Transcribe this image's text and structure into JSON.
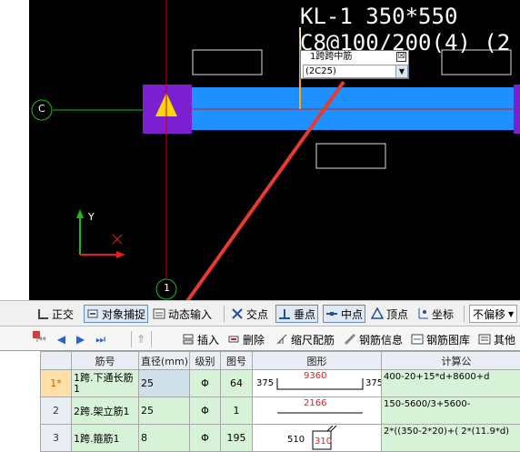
{
  "cad": {
    "beam_name": "KL-1 350*550",
    "stirrup_spec": "C8@100/200(4)  (2",
    "grid_c_label": "C",
    "grid_1_label": "1",
    "axis_y_label": "Y",
    "axis_x_label": "X",
    "popup": {
      "title": "1跨跨中筋",
      "value": "(2C25)",
      "close_glyph": "☒"
    },
    "colors": {
      "background": "#000000",
      "beam": "#1e90ff",
      "column": "#7b1fd1",
      "grid": "#c80000",
      "highlight_line": "#ffa500",
      "arrow": "#e83a2e"
    }
  },
  "snap_toolbar": {
    "ortho": "正交",
    "object_snap": "对象捕捉",
    "dynamic_input": "动态输入",
    "intersection": "交点",
    "perpendicular": "垂点",
    "midpoint": "中点",
    "vertex": "顶点",
    "coordinate": "坐标",
    "offset_select": "不偏移"
  },
  "rebar_toolbar": {
    "insert": "插入",
    "delete": "删除",
    "scale_rebar": "缩尺配筋",
    "rebar_info": "钢筋信息",
    "rebar_library": "钢筋图库",
    "other": "其他"
  },
  "grid": {
    "headers": [
      "筋号",
      "直径(mm)",
      "级别",
      "图号",
      "图形",
      "计算公"
    ],
    "rows": [
      {
        "num": "1*",
        "name": "1跨.下通长筋1",
        "dia": "25",
        "grade": "Φ",
        "fig": "64",
        "shape_left": "375",
        "shape_mid": "9360",
        "shape_right": "375",
        "formula": "400-20+15*d+8600+d"
      },
      {
        "num": "2",
        "name": "2跨.架立筋1",
        "dia": "25",
        "grade": "Φ",
        "fig": "1",
        "shape_mid": "2166",
        "formula": "150-5600/3+5600-"
      },
      {
        "num": "3",
        "name": "1跨.箍筋1",
        "dia": "8",
        "grade": "Φ",
        "fig": "195",
        "shape_left": "510",
        "shape_mid": "310",
        "formula": "2*((350-2*20)+(\n2*(11.9*d)"
      }
    ]
  }
}
